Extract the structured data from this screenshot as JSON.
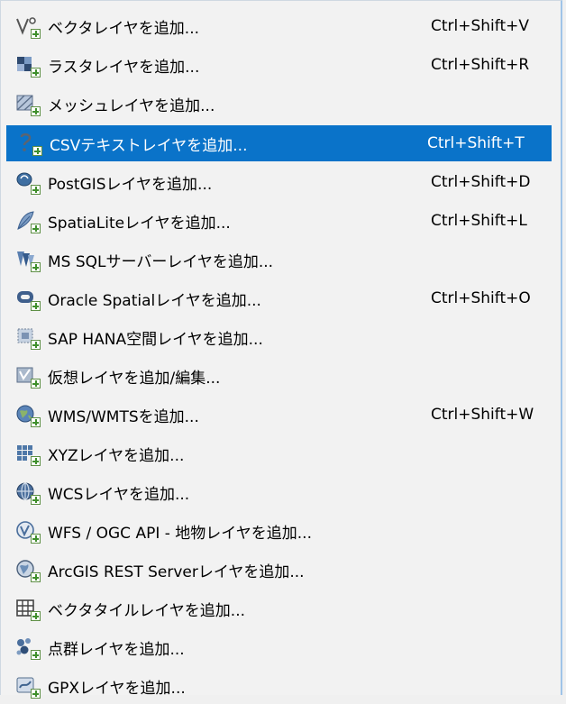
{
  "menu": {
    "items": [
      {
        "label": "ベクタレイヤを追加...",
        "shortcut": "Ctrl+Shift+V",
        "icon": "vector-layer-icon"
      },
      {
        "label": "ラスタレイヤを追加...",
        "shortcut": "Ctrl+Shift+R",
        "icon": "raster-layer-icon"
      },
      {
        "label": "メッシュレイヤを追加...",
        "shortcut": "",
        "icon": "mesh-layer-icon"
      },
      {
        "label": "CSVテキストレイヤを追加...",
        "shortcut": "Ctrl+Shift+T",
        "icon": "csv-text-layer-icon",
        "active": true
      },
      {
        "label": "PostGISレイヤを追加...",
        "shortcut": "Ctrl+Shift+D",
        "icon": "postgis-icon"
      },
      {
        "label": "SpatiaLiteレイヤを追加...",
        "shortcut": "Ctrl+Shift+L",
        "icon": "spatialite-icon"
      },
      {
        "label": "MS SQLサーバーレイヤを追加...",
        "shortcut": "",
        "icon": "mssql-icon"
      },
      {
        "label": "Oracle Spatialレイヤを追加...",
        "shortcut": "Ctrl+Shift+O",
        "icon": "oracle-icon"
      },
      {
        "label": "SAP HANA空間レイヤを追加...",
        "shortcut": "",
        "icon": "sap-hana-icon"
      },
      {
        "label": "仮想レイヤを追加/編集...",
        "shortcut": "",
        "icon": "virtual-layer-icon"
      },
      {
        "label": "WMS/WMTSを追加...",
        "shortcut": "Ctrl+Shift+W",
        "icon": "wms-icon"
      },
      {
        "label": "XYZレイヤを追加...",
        "shortcut": "",
        "icon": "xyz-icon"
      },
      {
        "label": "WCSレイヤを追加...",
        "shortcut": "",
        "icon": "wcs-icon"
      },
      {
        "label": "WFS / OGC API - 地物レイヤを追加...",
        "shortcut": "",
        "icon": "wfs-icon"
      },
      {
        "label": "ArcGIS REST Serverレイヤを追加...",
        "shortcut": "",
        "icon": "arcgis-rest-icon"
      },
      {
        "label": "ベクタタイルレイヤを追加...",
        "shortcut": "",
        "icon": "vector-tile-icon"
      },
      {
        "label": "点群レイヤを追加...",
        "shortcut": "",
        "icon": "point-cloud-icon"
      },
      {
        "label": "GPXレイヤを追加...",
        "shortcut": "",
        "icon": "gpx-icon"
      }
    ]
  },
  "colors": {
    "highlight": "#0a73c9",
    "background": "#f2f2f2"
  }
}
